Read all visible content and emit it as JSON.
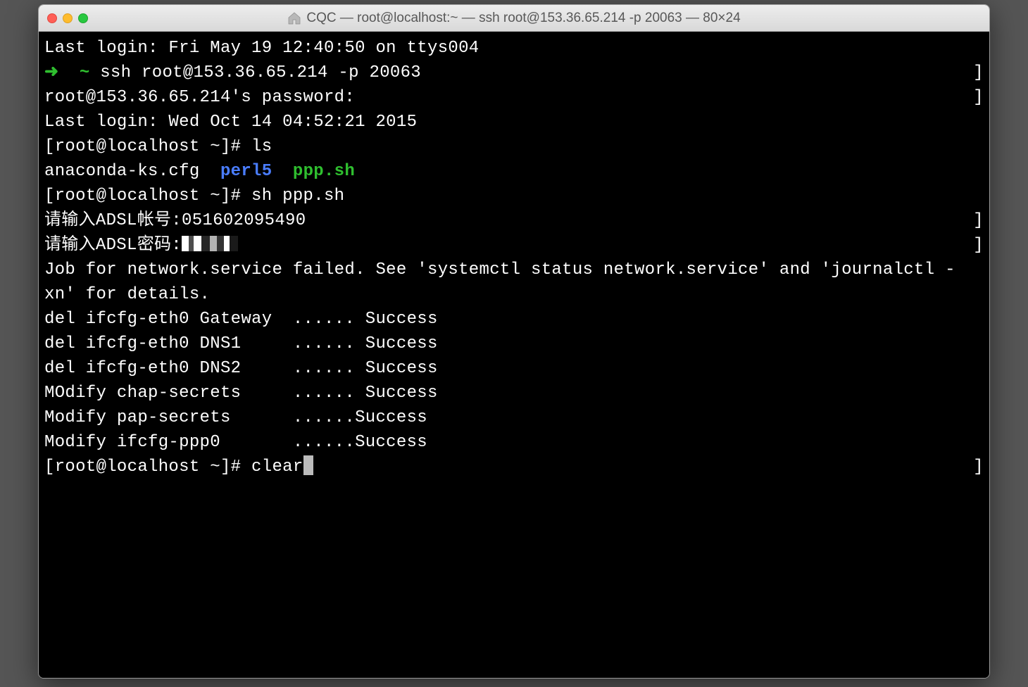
{
  "window": {
    "title": "CQC — root@localhost:~ — ssh root@153.36.65.214 -p 20063 — 80×24"
  },
  "terminal": {
    "lastLoginLocal": "Last login: Fri May 19 12:40:50 on ttys004",
    "promptArrow": "➜",
    "promptTilde": "~",
    "sshCmd": "ssh root@153.36.65.214 -p 20063",
    "passwordPrompt": "root@153.36.65.214's password:",
    "lastLoginRemote": "Last login: Wed Oct 14 04:52:21 2015",
    "shellPrompt": "[root@localhost ~]# ",
    "lsCmd": "ls",
    "lsOut": {
      "file1": "anaconda-ks.cfg",
      "file2": "perl5",
      "file3": "ppp.sh"
    },
    "shCmd": "sh ppp.sh",
    "adslAccountPrompt": "请输入ADSL帐号:",
    "adslAccountValue": "051602095490",
    "adslPwdPrompt": "请输入ADSL密码:",
    "networkFail": "Job for network.service failed. See 'systemctl status network.service' and 'journalctl -xn' for details.",
    "rows": [
      "del ifcfg-eth0 Gateway  ...... Success",
      "del ifcfg-eth0 DNS1     ...... Success",
      "del ifcfg-eth0 DNS2     ...... Success",
      "MOdify chap-secrets     ...... Success",
      "Modify pap-secrets      ......Success",
      "Modify ifcfg-ppp0       ......Success"
    ],
    "clearCmd": "clear"
  }
}
